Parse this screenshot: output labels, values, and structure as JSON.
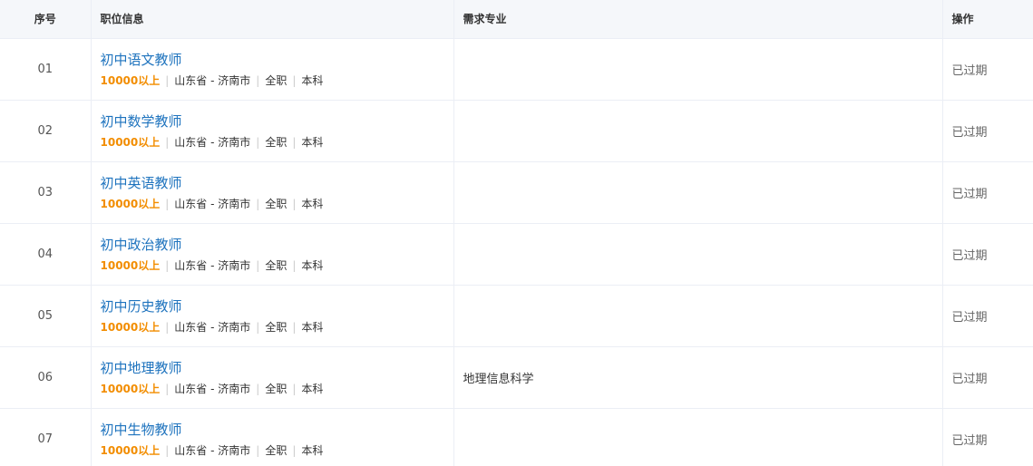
{
  "header": {
    "index": "序号",
    "info": "职位信息",
    "major": "需求专业",
    "action": "操作"
  },
  "separator": "|",
  "rows": [
    {
      "index": "01",
      "title": "初中语文教师",
      "salary": "10000以上",
      "location": "山东省 - 济南市",
      "type": "全职",
      "education": "本科",
      "major": "",
      "action": "已过期"
    },
    {
      "index": "02",
      "title": "初中数学教师",
      "salary": "10000以上",
      "location": "山东省 - 济南市",
      "type": "全职",
      "education": "本科",
      "major": "",
      "action": "已过期"
    },
    {
      "index": "03",
      "title": "初中英语教师",
      "salary": "10000以上",
      "location": "山东省 - 济南市",
      "type": "全职",
      "education": "本科",
      "major": "",
      "action": "已过期"
    },
    {
      "index": "04",
      "title": "初中政治教师",
      "salary": "10000以上",
      "location": "山东省 - 济南市",
      "type": "全职",
      "education": "本科",
      "major": "",
      "action": "已过期"
    },
    {
      "index": "05",
      "title": "初中历史教师",
      "salary": "10000以上",
      "location": "山东省 - 济南市",
      "type": "全职",
      "education": "本科",
      "major": "",
      "action": "已过期"
    },
    {
      "index": "06",
      "title": "初中地理教师",
      "salary": "10000以上",
      "location": "山东省 - 济南市",
      "type": "全职",
      "education": "本科",
      "major": "地理信息科学",
      "action": "已过期"
    },
    {
      "index": "07",
      "title": "初中生物教师",
      "salary": "10000以上",
      "location": "山东省 - 济南市",
      "type": "全职",
      "education": "本科",
      "major": "",
      "action": "已过期"
    }
  ]
}
